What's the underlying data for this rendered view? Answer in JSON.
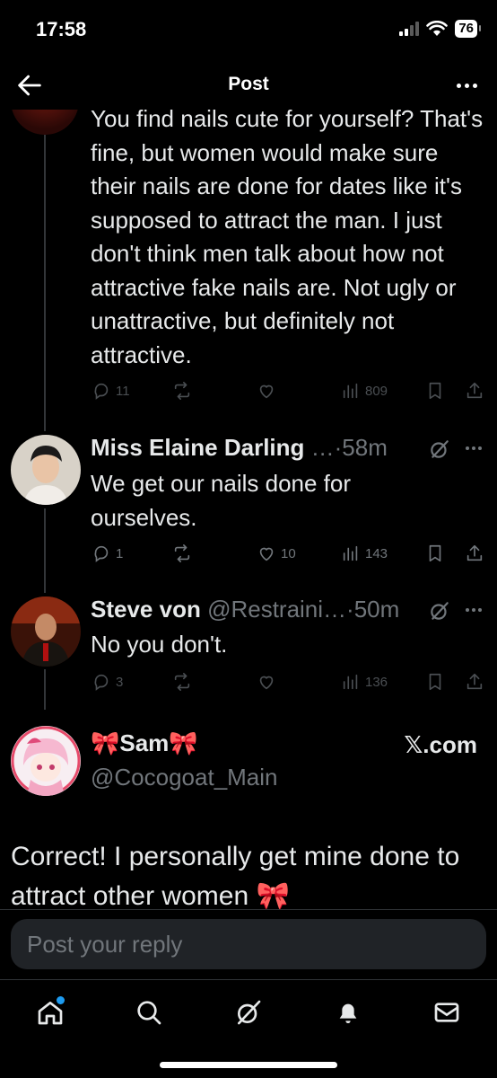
{
  "status_bar": {
    "time": "17:58",
    "battery": "76"
  },
  "header": {
    "title": "Post"
  },
  "tweets": [
    {
      "text": "You find nails cute for yourself? That's fine, but women would make sure their nails are done for dates like it's supposed to attract the man. I just don't think men talk about how not attractive fake nails are. Not ugly or unattractive, but definitely not attractive.",
      "replies": "11",
      "retweets": "",
      "likes": "",
      "views": "809"
    },
    {
      "name": "Miss Elaine Darling",
      "handle": "…",
      "time": "·58m",
      "text": "We get our nails done for ourselves.",
      "replies": "1",
      "retweets": "",
      "likes": "10",
      "views": "143"
    },
    {
      "name": "Steve von",
      "handle": "@Restraini…",
      "time": "·50m",
      "text": "No you don't.",
      "replies": "3",
      "retweets": "",
      "likes": "",
      "views": "136"
    }
  ],
  "embedded_post": {
    "name": "🎀Sam🎀",
    "handle": "@Cocogoat_Main",
    "source": "𝕏.com",
    "text": "Correct! I personally get mine done to attract other women 🎀"
  },
  "reply": {
    "placeholder": "Post your reply"
  },
  "nav": {
    "items": [
      "home-icon",
      "search-icon",
      "grok-icon",
      "notifications-icon",
      "messages-icon"
    ],
    "active": "home",
    "badge_color": "#1d9bf0"
  },
  "colors": {
    "background": "#000000",
    "text": "#e7e9ea",
    "muted": "#71767b",
    "accent": "#1d9bf0",
    "input_bg": "#202327"
  }
}
